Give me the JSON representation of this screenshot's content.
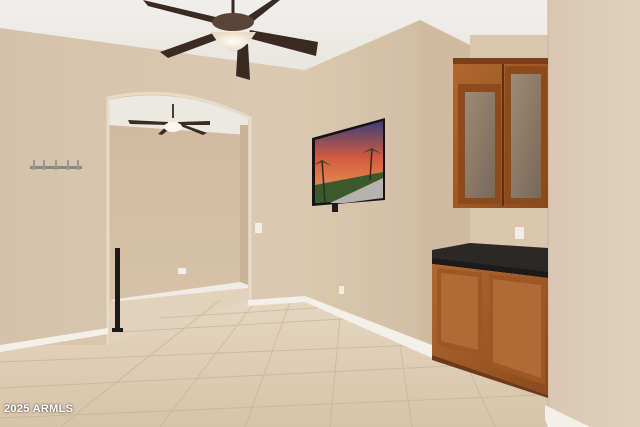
{
  "watermark": "2025 ARMLS"
}
